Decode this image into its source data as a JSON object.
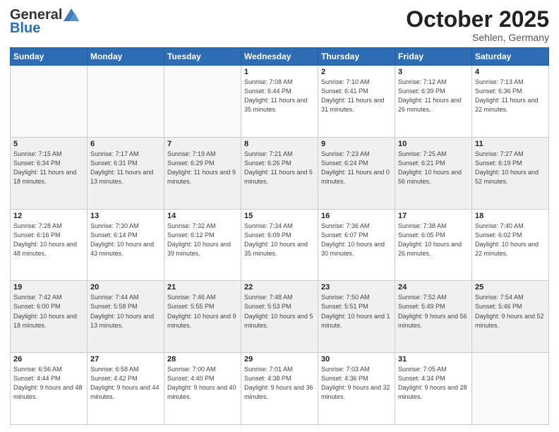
{
  "logo": {
    "text_general": "General",
    "text_blue": "Blue"
  },
  "header": {
    "month": "October 2025",
    "location": "Sehlen, Germany"
  },
  "days_of_week": [
    "Sunday",
    "Monday",
    "Tuesday",
    "Wednesday",
    "Thursday",
    "Friday",
    "Saturday"
  ],
  "weeks": [
    [
      {
        "day": "",
        "sunrise": "",
        "sunset": "",
        "daylight": ""
      },
      {
        "day": "",
        "sunrise": "",
        "sunset": "",
        "daylight": ""
      },
      {
        "day": "",
        "sunrise": "",
        "sunset": "",
        "daylight": ""
      },
      {
        "day": "1",
        "sunrise": "Sunrise: 7:08 AM",
        "sunset": "Sunset: 6:44 PM",
        "daylight": "Daylight: 11 hours and 35 minutes."
      },
      {
        "day": "2",
        "sunrise": "Sunrise: 7:10 AM",
        "sunset": "Sunset: 6:41 PM",
        "daylight": "Daylight: 11 hours and 31 minutes."
      },
      {
        "day": "3",
        "sunrise": "Sunrise: 7:12 AM",
        "sunset": "Sunset: 6:39 PM",
        "daylight": "Daylight: 11 hours and 26 minutes."
      },
      {
        "day": "4",
        "sunrise": "Sunrise: 7:13 AM",
        "sunset": "Sunset: 6:36 PM",
        "daylight": "Daylight: 11 hours and 22 minutes."
      }
    ],
    [
      {
        "day": "5",
        "sunrise": "Sunrise: 7:15 AM",
        "sunset": "Sunset: 6:34 PM",
        "daylight": "Daylight: 11 hours and 18 minutes."
      },
      {
        "day": "6",
        "sunrise": "Sunrise: 7:17 AM",
        "sunset": "Sunset: 6:31 PM",
        "daylight": "Daylight: 11 hours and 13 minutes."
      },
      {
        "day": "7",
        "sunrise": "Sunrise: 7:19 AM",
        "sunset": "Sunset: 6:29 PM",
        "daylight": "Daylight: 11 hours and 9 minutes."
      },
      {
        "day": "8",
        "sunrise": "Sunrise: 7:21 AM",
        "sunset": "Sunset: 6:26 PM",
        "daylight": "Daylight: 11 hours and 5 minutes."
      },
      {
        "day": "9",
        "sunrise": "Sunrise: 7:23 AM",
        "sunset": "Sunset: 6:24 PM",
        "daylight": "Daylight: 11 hours and 0 minutes."
      },
      {
        "day": "10",
        "sunrise": "Sunrise: 7:25 AM",
        "sunset": "Sunset: 6:21 PM",
        "daylight": "Daylight: 10 hours and 56 minutes."
      },
      {
        "day": "11",
        "sunrise": "Sunrise: 7:27 AM",
        "sunset": "Sunset: 6:19 PM",
        "daylight": "Daylight: 10 hours and 52 minutes."
      }
    ],
    [
      {
        "day": "12",
        "sunrise": "Sunrise: 7:28 AM",
        "sunset": "Sunset: 6:16 PM",
        "daylight": "Daylight: 10 hours and 48 minutes."
      },
      {
        "day": "13",
        "sunrise": "Sunrise: 7:30 AM",
        "sunset": "Sunset: 6:14 PM",
        "daylight": "Daylight: 10 hours and 43 minutes."
      },
      {
        "day": "14",
        "sunrise": "Sunrise: 7:32 AM",
        "sunset": "Sunset: 6:12 PM",
        "daylight": "Daylight: 10 hours and 39 minutes."
      },
      {
        "day": "15",
        "sunrise": "Sunrise: 7:34 AM",
        "sunset": "Sunset: 6:09 PM",
        "daylight": "Daylight: 10 hours and 35 minutes."
      },
      {
        "day": "16",
        "sunrise": "Sunrise: 7:36 AM",
        "sunset": "Sunset: 6:07 PM",
        "daylight": "Daylight: 10 hours and 30 minutes."
      },
      {
        "day": "17",
        "sunrise": "Sunrise: 7:38 AM",
        "sunset": "Sunset: 6:05 PM",
        "daylight": "Daylight: 10 hours and 26 minutes."
      },
      {
        "day": "18",
        "sunrise": "Sunrise: 7:40 AM",
        "sunset": "Sunset: 6:02 PM",
        "daylight": "Daylight: 10 hours and 22 minutes."
      }
    ],
    [
      {
        "day": "19",
        "sunrise": "Sunrise: 7:42 AM",
        "sunset": "Sunset: 6:00 PM",
        "daylight": "Daylight: 10 hours and 18 minutes."
      },
      {
        "day": "20",
        "sunrise": "Sunrise: 7:44 AM",
        "sunset": "Sunset: 5:58 PM",
        "daylight": "Daylight: 10 hours and 13 minutes."
      },
      {
        "day": "21",
        "sunrise": "Sunrise: 7:46 AM",
        "sunset": "Sunset: 5:55 PM",
        "daylight": "Daylight: 10 hours and 9 minutes."
      },
      {
        "day": "22",
        "sunrise": "Sunrise: 7:48 AM",
        "sunset": "Sunset: 5:53 PM",
        "daylight": "Daylight: 10 hours and 5 minutes."
      },
      {
        "day": "23",
        "sunrise": "Sunrise: 7:50 AM",
        "sunset": "Sunset: 5:51 PM",
        "daylight": "Daylight: 10 hours and 1 minute."
      },
      {
        "day": "24",
        "sunrise": "Sunrise: 7:52 AM",
        "sunset": "Sunset: 5:49 PM",
        "daylight": "Daylight: 9 hours and 56 minutes."
      },
      {
        "day": "25",
        "sunrise": "Sunrise: 7:54 AM",
        "sunset": "Sunset: 5:46 PM",
        "daylight": "Daylight: 9 hours and 52 minutes."
      }
    ],
    [
      {
        "day": "26",
        "sunrise": "Sunrise: 6:56 AM",
        "sunset": "Sunset: 4:44 PM",
        "daylight": "Daylight: 9 hours and 48 minutes."
      },
      {
        "day": "27",
        "sunrise": "Sunrise: 6:58 AM",
        "sunset": "Sunset: 4:42 PM",
        "daylight": "Daylight: 9 hours and 44 minutes."
      },
      {
        "day": "28",
        "sunrise": "Sunrise: 7:00 AM",
        "sunset": "Sunset: 4:40 PM",
        "daylight": "Daylight: 9 hours and 40 minutes."
      },
      {
        "day": "29",
        "sunrise": "Sunrise: 7:01 AM",
        "sunset": "Sunset: 4:38 PM",
        "daylight": "Daylight: 9 hours and 36 minutes."
      },
      {
        "day": "30",
        "sunrise": "Sunrise: 7:03 AM",
        "sunset": "Sunset: 4:36 PM",
        "daylight": "Daylight: 9 hours and 32 minutes."
      },
      {
        "day": "31",
        "sunrise": "Sunrise: 7:05 AM",
        "sunset": "Sunset: 4:34 PM",
        "daylight": "Daylight: 9 hours and 28 minutes."
      },
      {
        "day": "",
        "sunrise": "",
        "sunset": "",
        "daylight": ""
      }
    ]
  ]
}
